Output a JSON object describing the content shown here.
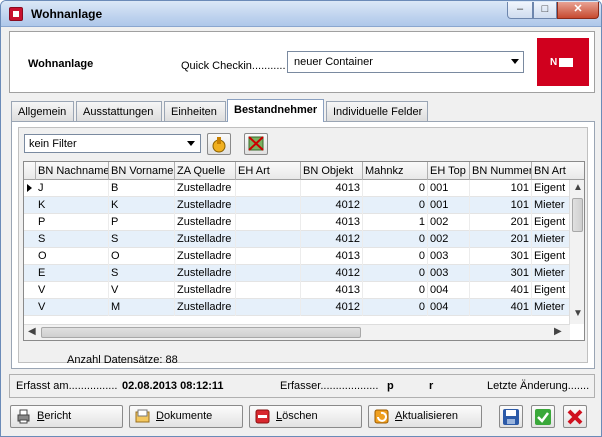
{
  "window": {
    "title": "Wohnanlage",
    "min": "–",
    "max": "□",
    "close": "✕"
  },
  "header": {
    "title": "Wohnanlage",
    "quick_checkin_label": "Quick Checkin...........",
    "quick_checkin_value": "neuer Container",
    "logo_text": "N"
  },
  "tabs": [
    {
      "label": "Allgemein"
    },
    {
      "label": "Ausstattungen"
    },
    {
      "label": "Einheiten"
    },
    {
      "label": "Bestandnehmer"
    },
    {
      "label": "Individuelle Felder"
    }
  ],
  "filter": {
    "value": "kein Filter"
  },
  "grid": {
    "columns": [
      "BN Nachname",
      "BN Vorname",
      "ZA Quelle",
      "EH Art",
      "BN Objekt",
      "Mahnkz",
      "EH Top",
      "BN Nummer",
      "BN Art"
    ],
    "rows": [
      [
        "J",
        "B",
        "Zustelladre",
        "",
        "4013",
        "0",
        "001",
        "101",
        "Eigent"
      ],
      [
        "K",
        "K",
        "Zustelladre",
        "",
        "4012",
        "0",
        "001",
        "101",
        "Mieter"
      ],
      [
        "P",
        "P",
        "Zustelladre",
        "",
        "4013",
        "1",
        "002",
        "201",
        "Eigent"
      ],
      [
        "S",
        "S",
        "Zustelladre",
        "",
        "4012",
        "0",
        "002",
        "201",
        "Mieter"
      ],
      [
        "O",
        "O",
        "Zustelladre",
        "",
        "4013",
        "0",
        "003",
        "301",
        "Eigent"
      ],
      [
        "E",
        "S",
        "Zustelladre",
        "",
        "4012",
        "0",
        "003",
        "301",
        "Mieter"
      ],
      [
        "V",
        "V",
        "Zustelladre",
        "",
        "4013",
        "0",
        "004",
        "401",
        "Eigent"
      ],
      [
        "V",
        "M",
        "Zustelladre",
        "",
        "4012",
        "0",
        "004",
        "401",
        "Mieter"
      ]
    ]
  },
  "record_count": "Anzahl Datensätze: 88",
  "info": {
    "erfasst_label": "Erfasst am................",
    "erfasst_value": "02.08.2013 08:12:11",
    "erfasser_label": "Erfasser...................",
    "erfasser_value_a": "p",
    "erfasser_value_b": "r",
    "aenderung_label": "Letzte Änderung......."
  },
  "footer": {
    "bericht_u": "B",
    "bericht_rest": "ericht",
    "dokumente_u": "D",
    "dokumente_rest": "okumente",
    "loeschen_u": "L",
    "loeschen_rest": "öschen",
    "aktualisieren_u": "A",
    "aktualisieren_rest": "ktualisieren"
  },
  "colors": {
    "accent": "#d0001e",
    "alt_row": "#e6f0fa"
  }
}
